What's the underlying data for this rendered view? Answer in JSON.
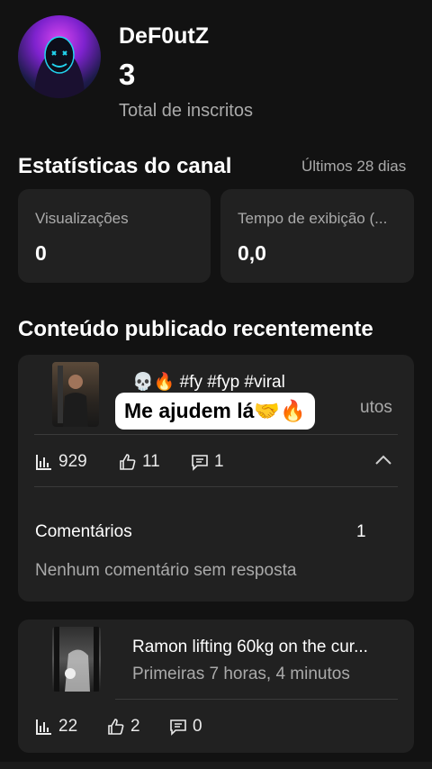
{
  "profile": {
    "channel_name": "DeF0utZ",
    "subscriber_count": "3",
    "subscriber_label": "Total de inscritos"
  },
  "stats": {
    "title": "Estatísticas do canal",
    "period": "Últimos 28 dias",
    "cards": [
      {
        "label": "Visualizações",
        "value": "0"
      },
      {
        "label": "Tempo de exibição (...",
        "value": "0,0"
      }
    ]
  },
  "recent": {
    "title": "Conteúdo publicado recentemente",
    "videos": [
      {
        "title": "💀🔥 #fy #fyp #viral",
        "subtitle_partial": "utos",
        "overlay_caption": "Me ajudem lá🤝🔥",
        "views": "929",
        "likes": "11",
        "comments": "1",
        "comments_section": {
          "label": "Comentários",
          "count": "1",
          "no_reply_text": "Nenhum comentário sem resposta"
        }
      },
      {
        "title": "Ramon lifting 60kg on the cur...",
        "subtitle": "Primeiras 7 horas, 4 minutos",
        "views": "22",
        "likes": "2",
        "comments": "0"
      }
    ]
  },
  "icons": {
    "views": "bar-chart-icon",
    "likes": "thumbs-up-icon",
    "comments": "comment-icon",
    "expand": "chevron-up-icon"
  },
  "colors": {
    "background": "#121212",
    "card": "#212121",
    "muted_text": "#aaaaaa"
  }
}
